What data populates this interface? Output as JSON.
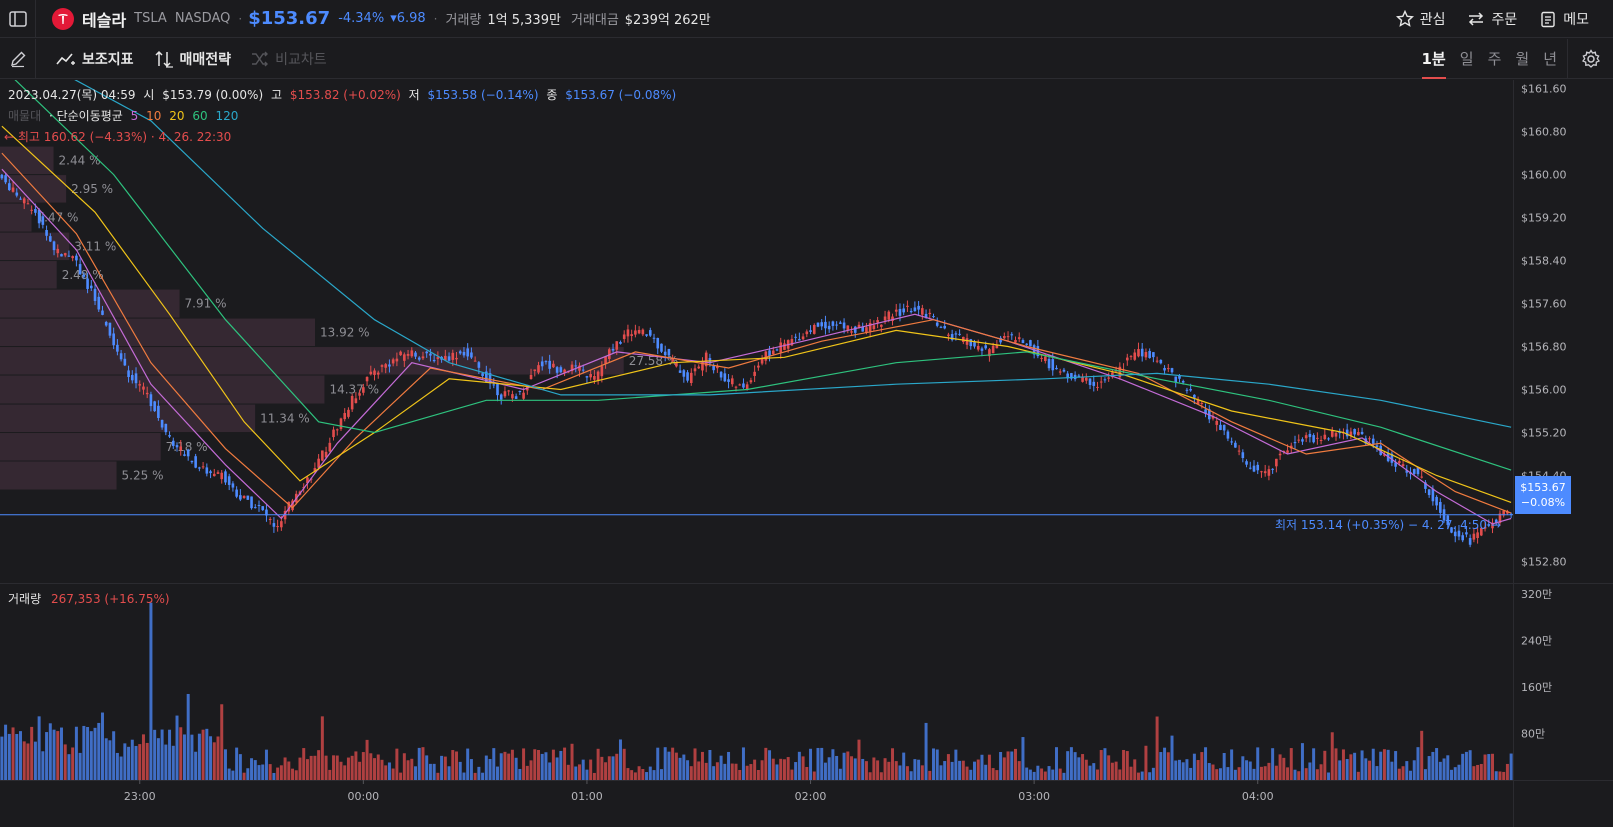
{
  "header": {
    "stock_name": "테슬라",
    "symbol": "TSLA",
    "exchange": "NASDAQ",
    "separator": "·",
    "price": "$153.67",
    "change_pct": "-4.34%",
    "change_abs": "▾6.98",
    "volume_label": "거래량",
    "volume_value": "1억 5,339만",
    "amount_label": "거래대금",
    "amount_value": "$239억 262만",
    "actions": {
      "watch": "관심",
      "order": "주문",
      "memo": "메모"
    }
  },
  "toolbar": {
    "indicators": "보조지표",
    "strategy": "매매전략",
    "compare": "비교차트",
    "periods": [
      "1분",
      "일",
      "주",
      "월",
      "년"
    ],
    "active_period": "1분"
  },
  "ohlc": {
    "date": "2023.04.27(목) 04:59",
    "open_label": "시",
    "open": "$153.79 (0.00%)",
    "high_label": "고",
    "high": "$153.82 (+0.02%)",
    "low_label": "저",
    "low": "$153.58 (−0.14%)",
    "close_label": "종",
    "close": "$153.67 (−0.08%)"
  },
  "ma_legend": {
    "prefix": "매물대",
    "title": "· 단순이동평균",
    "periods": [
      "5",
      "10",
      "20",
      "60",
      "120"
    ]
  },
  "annotations": {
    "max": "← 최고 160.62 (−4.33%) · 4. 26. 22:30",
    "min": "최저 153.14 (+0.35%) − 4. 27. 4:50 →"
  },
  "current_tag": {
    "price": "$153.67",
    "change": "−0.08%"
  },
  "volume_legend": {
    "label": "거래량",
    "value": "267,353 (+16.75%)"
  },
  "colors": {
    "up": "#e34d4d",
    "down": "#4d8bff",
    "ma5": "#c36bd6",
    "ma10": "#f07b3f",
    "ma20": "#f0c419",
    "ma60": "#2ec27e",
    "ma120": "#2aa7c9",
    "profile": "#3a2a36",
    "background": "#1b1b1e"
  },
  "chart_data": {
    "type": "candlestick",
    "x_ticks": [
      "23:00",
      "00:00",
      "01:00",
      "02:00",
      "03:00",
      "04:00"
    ],
    "price_ticks": [
      "$161.60",
      "$160.80",
      "$160.00",
      "$159.20",
      "$158.40",
      "$157.60",
      "$156.80",
      "$156.00",
      "$155.20",
      "$154.40",
      "$152.80"
    ],
    "price_ylim": [
      152.4,
      161.76
    ],
    "current_price": 153.67,
    "volume_ticks": [
      "320만",
      "240만",
      "160만",
      "80만"
    ],
    "volume_ylim": [
      0,
      3200000
    ],
    "volume_profile": [
      {
        "price_low": 160.0,
        "price_high": 160.53,
        "pct": "2.44 %",
        "fraction": 0.17
      },
      {
        "price_low": 159.47,
        "price_high": 160.0,
        "pct": "2.95 %",
        "fraction": 0.21
      },
      {
        "price_low": 158.93,
        "price_high": 159.47,
        "pct": "1.47 %",
        "fraction": 0.1
      },
      {
        "price_low": 158.4,
        "price_high": 158.93,
        "pct": "3.11 %",
        "fraction": 0.22
      },
      {
        "price_low": 157.87,
        "price_high": 158.4,
        "pct": "2.48 %",
        "fraction": 0.18
      },
      {
        "price_low": 157.33,
        "price_high": 157.87,
        "pct": "7.91 %",
        "fraction": 0.57
      },
      {
        "price_low": 156.8,
        "price_high": 157.33,
        "pct": "13.92 %",
        "fraction": 1.0
      },
      {
        "price_low": 156.27,
        "price_high": 156.8,
        "pct": "27.58 %",
        "fraction": 1.98
      },
      {
        "price_low": 155.73,
        "price_high": 156.27,
        "pct": "14.37 %",
        "fraction": 1.03
      },
      {
        "price_low": 155.2,
        "price_high": 155.73,
        "pct": "11.34 %",
        "fraction": 0.81
      },
      {
        "price_low": 154.67,
        "price_high": 155.2,
        "pct": "7.18 %",
        "fraction": 0.51
      },
      {
        "price_low": 154.13,
        "price_high": 154.67,
        "pct": "5.25 %",
        "fraction": 0.37
      }
    ],
    "price_path": [
      [
        0,
        160.0
      ],
      [
        5,
        159.6
      ],
      [
        10,
        159.3
      ],
      [
        15,
        158.6
      ],
      [
        20,
        158.5
      ],
      [
        25,
        157.8
      ],
      [
        30,
        157.0
      ],
      [
        35,
        156.3
      ],
      [
        40,
        155.9
      ],
      [
        45,
        155.2
      ],
      [
        50,
        154.8
      ],
      [
        55,
        154.5
      ],
      [
        60,
        154.4
      ],
      [
        65,
        154.0
      ],
      [
        70,
        153.8
      ],
      [
        75,
        153.4
      ],
      [
        80,
        154.1
      ],
      [
        85,
        154.5
      ],
      [
        90,
        155.2
      ],
      [
        95,
        155.8
      ],
      [
        100,
        156.3
      ],
      [
        105,
        156.5
      ],
      [
        110,
        156.7
      ],
      [
        115,
        156.6
      ],
      [
        120,
        156.6
      ],
      [
        125,
        156.7
      ],
      [
        130,
        156.3
      ],
      [
        135,
        155.9
      ],
      [
        140,
        155.9
      ],
      [
        145,
        156.5
      ],
      [
        150,
        156.4
      ],
      [
        155,
        156.4
      ],
      [
        160,
        156.2
      ],
      [
        165,
        156.8
      ],
      [
        170,
        157.1
      ],
      [
        175,
        157.0
      ],
      [
        180,
        156.6
      ],
      [
        185,
        156.2
      ],
      [
        190,
        156.6
      ],
      [
        195,
        156.2
      ],
      [
        200,
        156.0
      ],
      [
        205,
        156.6
      ],
      [
        210,
        156.8
      ],
      [
        215,
        157.0
      ],
      [
        220,
        157.2
      ],
      [
        225,
        157.2
      ],
      [
        230,
        157.1
      ],
      [
        235,
        157.2
      ],
      [
        240,
        157.4
      ],
      [
        245,
        157.5
      ],
      [
        250,
        157.4
      ],
      [
        255,
        157.0
      ],
      [
        260,
        156.9
      ],
      [
        265,
        156.7
      ],
      [
        270,
        157.0
      ],
      [
        275,
        156.9
      ],
      [
        280,
        156.6
      ],
      [
        285,
        156.3
      ],
      [
        290,
        156.2
      ],
      [
        295,
        156.1
      ],
      [
        300,
        156.3
      ],
      [
        305,
        156.7
      ],
      [
        310,
        156.6
      ],
      [
        315,
        156.3
      ],
      [
        320,
        155.9
      ],
      [
        325,
        155.5
      ],
      [
        330,
        155.1
      ],
      [
        335,
        154.6
      ],
      [
        340,
        154.4
      ],
      [
        345,
        154.9
      ],
      [
        350,
        155.1
      ],
      [
        355,
        155.1
      ],
      [
        360,
        155.2
      ],
      [
        365,
        155.2
      ],
      [
        370,
        154.9
      ],
      [
        375,
        154.6
      ],
      [
        380,
        154.5
      ],
      [
        385,
        154.0
      ],
      [
        390,
        153.4
      ],
      [
        395,
        153.2
      ],
      [
        400,
        153.5
      ],
      [
        405,
        153.7
      ]
    ],
    "moving_averages": [
      {
        "name": "5",
        "points": [
          [
            0,
            160.1
          ],
          [
            20,
            158.6
          ],
          [
            40,
            156.1
          ],
          [
            60,
            154.6
          ],
          [
            75,
            153.6
          ],
          [
            90,
            155.0
          ],
          [
            110,
            156.5
          ],
          [
            140,
            156.0
          ],
          [
            165,
            156.7
          ],
          [
            190,
            156.5
          ],
          [
            215,
            156.9
          ],
          [
            245,
            157.4
          ],
          [
            270,
            156.9
          ],
          [
            300,
            156.2
          ],
          [
            325,
            155.5
          ],
          [
            345,
            154.8
          ],
          [
            365,
            155.1
          ],
          [
            385,
            154.1
          ],
          [
            400,
            153.5
          ],
          [
            405,
            153.6
          ]
        ]
      },
      {
        "name": "10",
        "points": [
          [
            0,
            160.4
          ],
          [
            20,
            158.9
          ],
          [
            40,
            156.5
          ],
          [
            60,
            154.9
          ],
          [
            78,
            153.8
          ],
          [
            95,
            155.1
          ],
          [
            115,
            156.4
          ],
          [
            145,
            156.0
          ],
          [
            170,
            156.7
          ],
          [
            195,
            156.4
          ],
          [
            220,
            156.9
          ],
          [
            250,
            157.3
          ],
          [
            275,
            156.8
          ],
          [
            305,
            156.3
          ],
          [
            330,
            155.4
          ],
          [
            350,
            154.8
          ],
          [
            370,
            155.0
          ],
          [
            390,
            154.1
          ],
          [
            405,
            153.7
          ]
        ]
      },
      {
        "name": "20",
        "points": [
          [
            0,
            160.9
          ],
          [
            25,
            159.3
          ],
          [
            45,
            157.4
          ],
          [
            65,
            155.4
          ],
          [
            80,
            154.3
          ],
          [
            100,
            155.2
          ],
          [
            120,
            156.2
          ],
          [
            150,
            156.0
          ],
          [
            180,
            156.5
          ],
          [
            210,
            156.6
          ],
          [
            240,
            157.1
          ],
          [
            270,
            156.8
          ],
          [
            300,
            156.3
          ],
          [
            330,
            155.6
          ],
          [
            360,
            155.2
          ],
          [
            385,
            154.4
          ],
          [
            405,
            153.9
          ]
        ]
      },
      {
        "name": "60",
        "points": [
          [
            0,
            162.0
          ],
          [
            30,
            160.0
          ],
          [
            60,
            157.3
          ],
          [
            85,
            155.4
          ],
          [
            100,
            155.2
          ],
          [
            130,
            155.8
          ],
          [
            160,
            155.8
          ],
          [
            200,
            156.0
          ],
          [
            240,
            156.5
          ],
          [
            275,
            156.7
          ],
          [
            310,
            156.2
          ],
          [
            340,
            155.8
          ],
          [
            370,
            155.3
          ],
          [
            405,
            154.5
          ]
        ]
      },
      {
        "name": "120",
        "points": [
          [
            0,
            162.5
          ],
          [
            40,
            161.0
          ],
          [
            70,
            159.0
          ],
          [
            100,
            157.3
          ],
          [
            120,
            156.5
          ],
          [
            150,
            155.9
          ],
          [
            190,
            155.9
          ],
          [
            240,
            156.1
          ],
          [
            280,
            156.2
          ],
          [
            310,
            156.3
          ],
          [
            340,
            156.1
          ],
          [
            370,
            155.8
          ],
          [
            405,
            155.3
          ]
        ]
      }
    ]
  }
}
